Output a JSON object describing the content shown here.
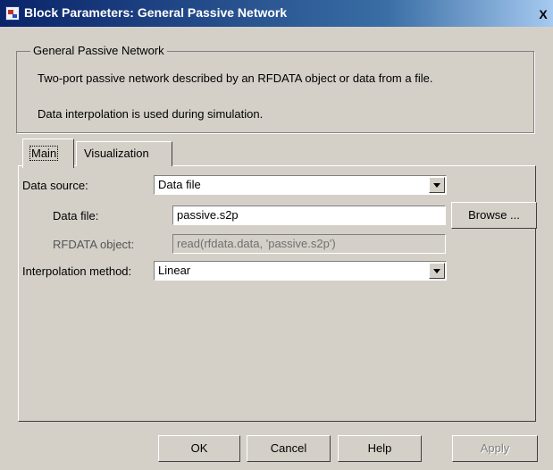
{
  "window": {
    "title": "Block Parameters: General Passive Network",
    "close_label": "X"
  },
  "group": {
    "legend": "General Passive Network",
    "description": "Two-port passive network described by an RFDATA object or data from a file.",
    "note": "Data interpolation is used during simulation."
  },
  "tabs": [
    {
      "label": "Main",
      "selected": true
    },
    {
      "label": "Visualization",
      "selected": false
    }
  ],
  "form": {
    "data_source_label": "Data source:",
    "data_source_value": "Data file",
    "data_file_label": "Data file:",
    "data_file_value": "passive.s2p",
    "browse_label": "Browse ...",
    "rfdata_label": "RFDATA object:",
    "rfdata_value": "read(rfdata.data, 'passive.s2p')",
    "interp_label": "Interpolation method:",
    "interp_value": "Linear"
  },
  "buttons": {
    "ok": "OK",
    "cancel": "Cancel",
    "help": "Help",
    "apply": "Apply"
  }
}
